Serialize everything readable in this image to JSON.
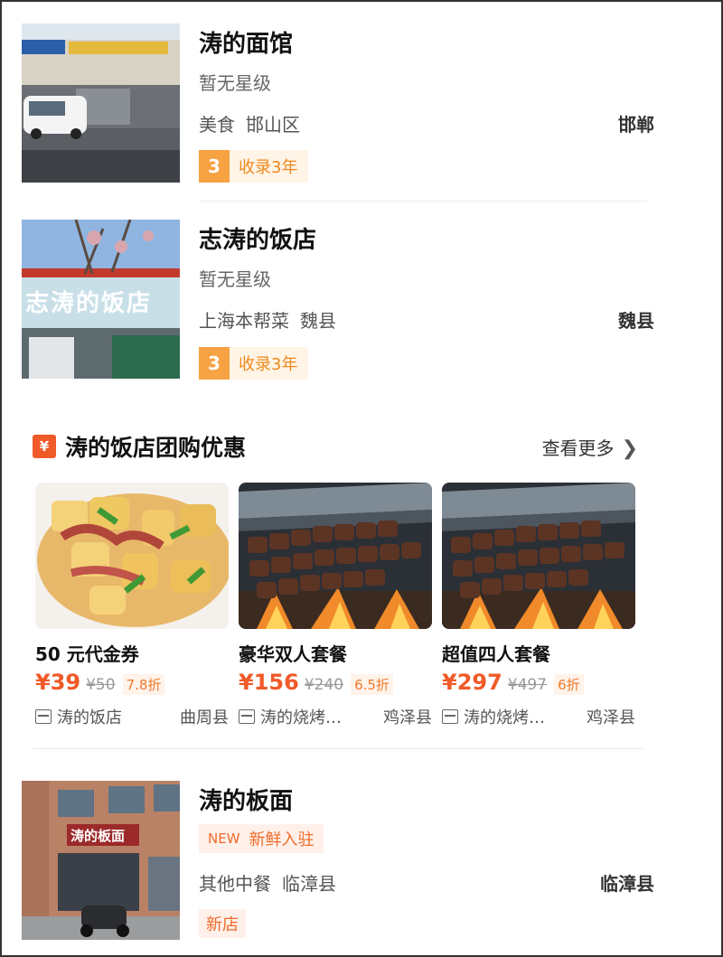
{
  "shops_top": [
    {
      "name": "涛的面馆",
      "rating": "暂无星级",
      "category": "美食",
      "district": "邯山区",
      "city": "邯郸",
      "years_num": "3",
      "years_text": "收录3年"
    },
    {
      "name": "志涛的饭店",
      "rating": "暂无星级",
      "category": "上海本帮菜",
      "district": "魏县",
      "city": "魏县",
      "years_num": "3",
      "years_text": "收录3年"
    }
  ],
  "deals_section": {
    "icon": "coupon-icon",
    "icon_glyph": "¥",
    "title": "涛的饭店团购优惠",
    "more_label": "查看更多",
    "items": [
      {
        "name": "50 元代金券",
        "price": "¥39",
        "original": "¥50",
        "discount": "7.8折",
        "shop": "涛的饭店",
        "location": "曲周县"
      },
      {
        "name": "豪华双人套餐",
        "price": "¥156",
        "original": "¥240",
        "discount": "6.5折",
        "shop": "涛的烧烤…",
        "location": "鸡泽县"
      },
      {
        "name": "超值四人套餐",
        "price": "¥297",
        "original": "¥497",
        "discount": "6折",
        "shop": "涛的烧烤…",
        "location": "鸡泽县"
      }
    ]
  },
  "shop_bottom": {
    "name": "涛的板面",
    "badge_en": "NEW",
    "badge_cn": "新鲜入驻",
    "category": "其他中餐",
    "district": "临漳县",
    "city": "临漳县",
    "new_tag": "新店",
    "sign_text": "涛的板面"
  },
  "photo_signs": {
    "shop2": "志涛的饭店"
  },
  "colors": {
    "accent": "#f05a28",
    "tag_orange": "#f7a243"
  }
}
